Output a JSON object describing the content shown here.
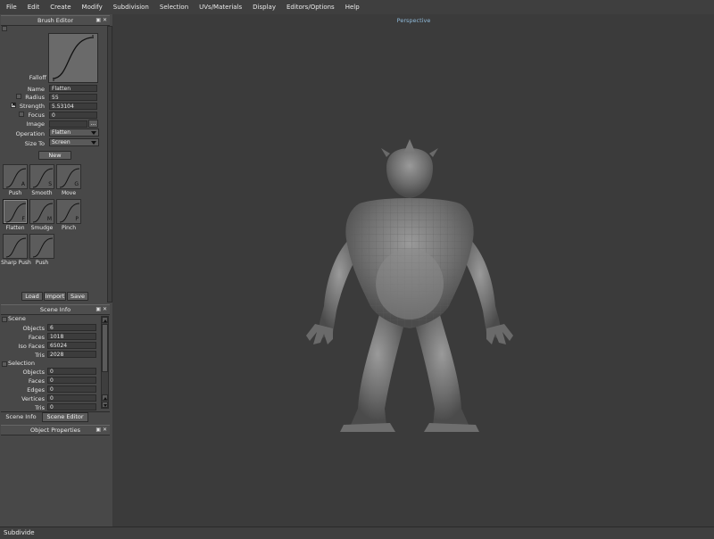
{
  "menu": [
    "File",
    "Edit",
    "Create",
    "Modify",
    "Subdivision",
    "Selection",
    "UVs/Materials",
    "Display",
    "Editors/Options",
    "Help"
  ],
  "brush_editor": {
    "title": "Brush Editor",
    "falloff_label": "Falloff",
    "name_label": "Name",
    "name_value": "Flatten",
    "radius_label": "Radius",
    "radius_value": "55",
    "strength_label": "Strength",
    "strength_value": "5.53104",
    "focus_label": "Focus",
    "focus_value": "0",
    "image_label": "Image",
    "image_value": "",
    "image_browse": "...",
    "operation_label": "Operation",
    "operation_value": "Flatten",
    "sizeto_label": "Size To",
    "sizeto_value": "Screen",
    "new_button": "New",
    "brushes": [
      {
        "label": "Push",
        "key": "A"
      },
      {
        "label": "Smooth",
        "key": "S"
      },
      {
        "label": "Move",
        "key": "G"
      },
      {
        "label": "Flatten",
        "key": "F"
      },
      {
        "label": "Smudge",
        "key": "M"
      },
      {
        "label": "Pinch",
        "key": "P"
      },
      {
        "label": "Sharp Push",
        "key": ""
      },
      {
        "label": "Push",
        "key": ""
      }
    ],
    "load_button": "Load",
    "import_button": "Import",
    "save_button": "Save"
  },
  "scene_info": {
    "title": "Scene Info",
    "scene_header": "Scene",
    "objects_label": "Objects",
    "objects_value": "6",
    "faces_label": "Faces",
    "faces_value": "1018",
    "isofaces_label": "Iso Faces",
    "isofaces_value": "65024",
    "tris_label": "Tris",
    "tris_value": "2028",
    "selection_header": "Selection",
    "sel_objects_label": "Objects",
    "sel_objects_value": "0",
    "sel_faces_label": "Faces",
    "sel_faces_value": "0",
    "sel_edges_label": "Edges",
    "sel_edges_value": "0",
    "sel_vertices_label": "Vertices",
    "sel_vertices_value": "0",
    "sel_tris_label": "Tris",
    "sel_tris_value": "0"
  },
  "tabs": {
    "scene_info": "Scene Info",
    "scene_editor": "Scene Editor"
  },
  "object_properties": {
    "title": "Object Properties"
  },
  "viewport": {
    "title": "Perspective"
  },
  "status": {
    "text": "Subdivide"
  },
  "colors": {
    "viewport_bg": "#3b3b3b",
    "panel_bg": "#484848",
    "viewport_title": "#8fb9d8"
  },
  "icons": {
    "panel_float": "float-icon",
    "panel_close": "close-icon"
  }
}
